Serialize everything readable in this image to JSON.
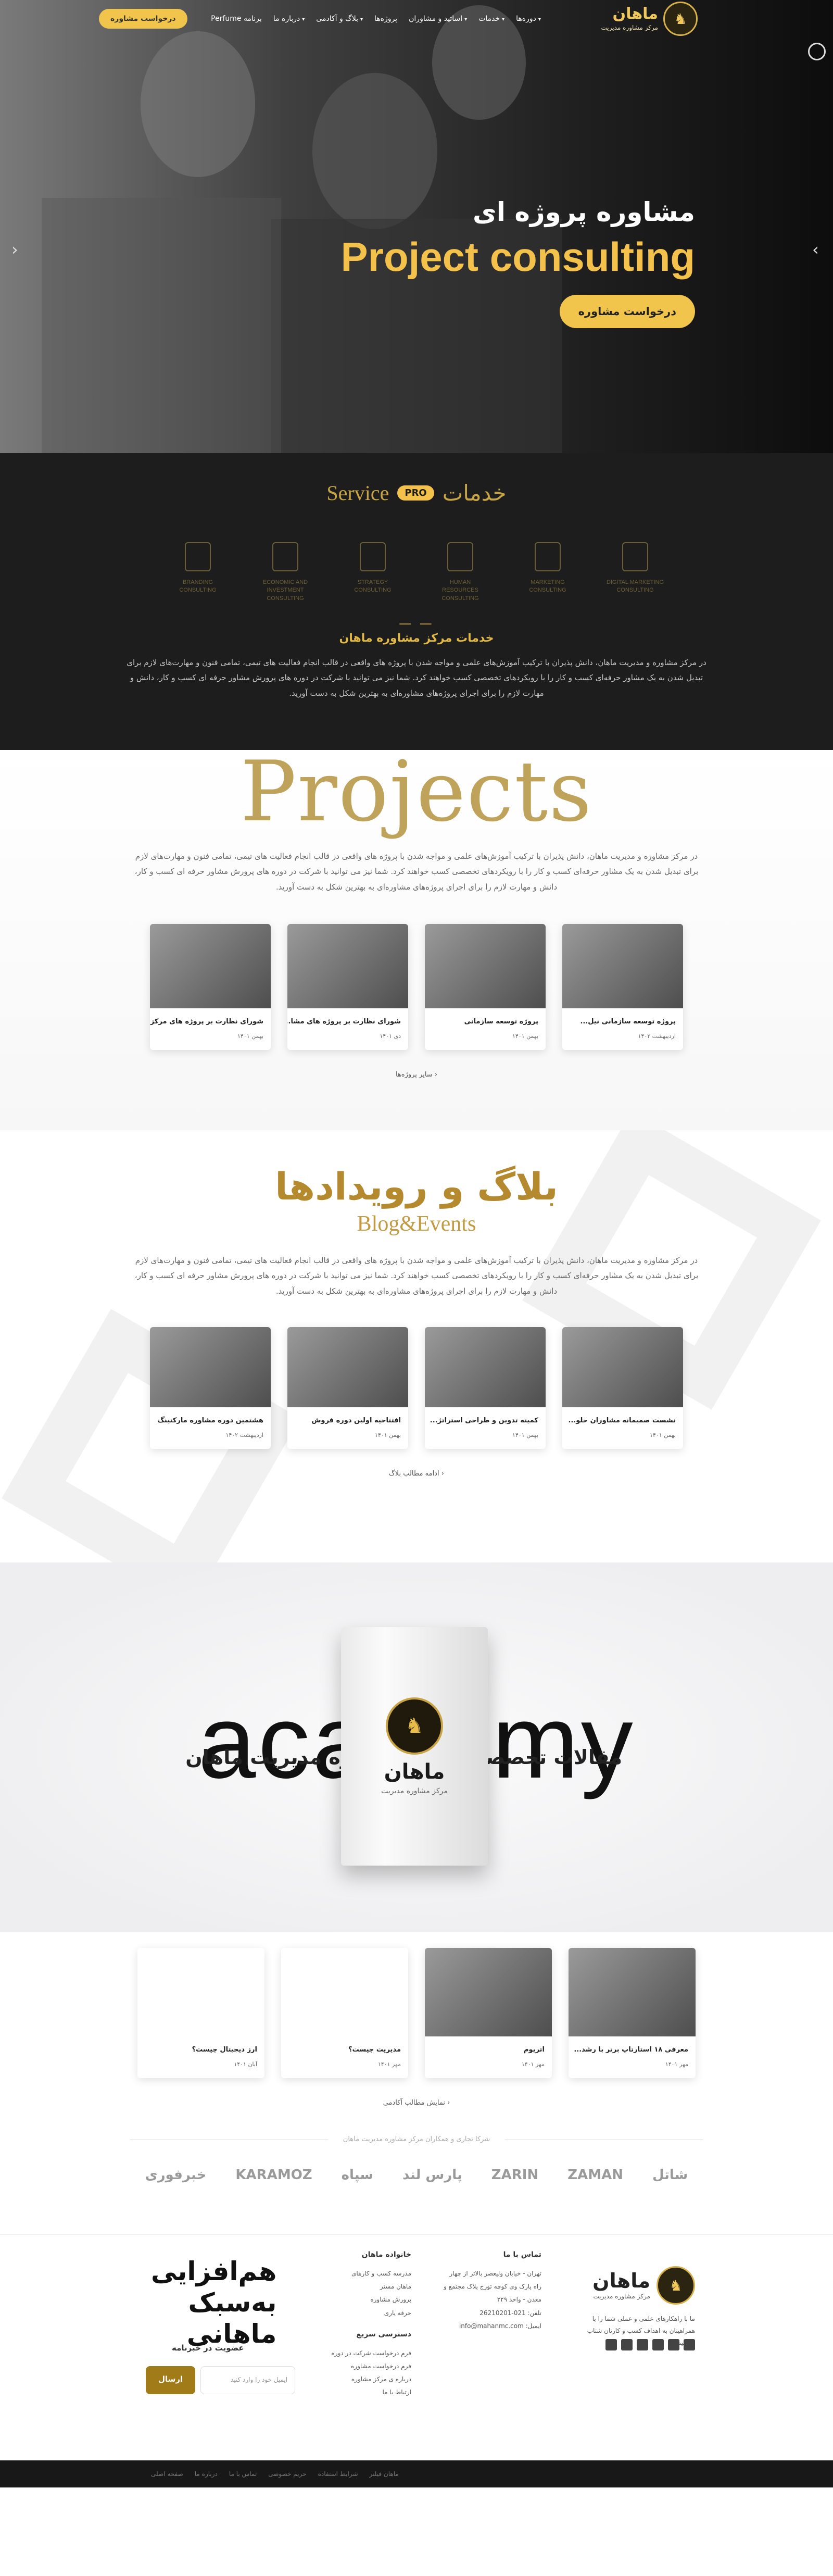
{
  "nav": {
    "logo_name": "ماهان",
    "logo_sub": "مرکز مشاوره مدیریت",
    "menu": [
      {
        "label": "دوره‌ها",
        "caret": true
      },
      {
        "label": "خدمات",
        "caret": true
      },
      {
        "label": "اساتید و مشاوران",
        "caret": true
      },
      {
        "label": "پروژه‌ها",
        "caret": false
      },
      {
        "label": "بلاگ و آکادمی",
        "caret": true
      },
      {
        "label": "درباره ما",
        "caret": true
      },
      {
        "label": "برنامه Perfume",
        "caret": false
      }
    ],
    "cta": "درخواست مشاوره"
  },
  "hero": {
    "title_fa": "مشاوره پروژه ای",
    "title_en": "Project consulting",
    "button": "درخواست مشاوره",
    "prev_icon": "chevron-left-icon",
    "next_icon": "chevron-right-icon"
  },
  "services": {
    "title_en": "Service",
    "badge": "PRO",
    "title_fa": "خدمات",
    "items": [
      {
        "label": "BRANDING CONSULTING"
      },
      {
        "label": "ECONOMIC AND INVESTMENT CONSULTING"
      },
      {
        "label": "STRATEGY CONSULTING"
      },
      {
        "label": "HUMAN RESOURCES CONSULTING"
      },
      {
        "label": "MARKETING CONSULTING"
      },
      {
        "label": "DIGITAL MARKETING CONSULTING"
      }
    ],
    "subtitle": "خدمات مرکز مشاوره ماهان",
    "paragraph": "در مرکز مشاوره و مدیریت ماهان، دانش پذیران با ترکیب آموزش‌های علمی و مواجه شدن با پروژه های واقعی در قالب انجام فعالیت های تیمی، تمامی فنون و مهارت‌های لازم برای تبدیل شدن به یک مشاور حرفه‌ای کسب و کار را با رویکردهای تخصصی کسب خواهند کرد. شما نیز می توانید با شرکت در دوره های پرورش مشاور حرفه ای کسب و کار، دانش و مهارت لازم را برای اجرای پروژه‌های مشاوره‌ای به بهترین شکل به دست آورید."
  },
  "projects": {
    "big_title": "Projects",
    "paragraph": "در مرکز مشاوره و مدیریت ماهان، دانش پذیران با ترکیب آموزش‌های علمی و مواجه شدن با پروژه های واقعی در قالب انجام فعالیت های تیمی، تمامی فنون و مهارت‌های لازم برای تبدیل شدن به یک مشاور حرفه‌ای کسب و کار را با رویکردهای تخصصی کسب خواهند کرد. شما نیز می توانید با شرکت در دوره های پرورش مشاور حرفه ای کسب و کار، دانش و مهارت لازم را برای اجرای پروژه‌های مشاوره‌ای به بهترین شکل به دست آورید.",
    "cards": [
      {
        "title": "پروژه توسعه سازمانی نیل...",
        "date": "اردیبهشت ۱۴۰۲"
      },
      {
        "title": "پروژه توسعه سازمانی",
        "date": "بهمن ۱۴۰۱"
      },
      {
        "title": "شورای نظارت بر پروژه های مشا...",
        "date": "دی ۱۴۰۱"
      },
      {
        "title": "شورای نظارت بر پروژه های مرکز ...",
        "date": "بهمن ۱۴۰۱"
      }
    ],
    "more": "سایر پروژه‌ها"
  },
  "blog": {
    "title_fa": "بلاگ و رویدادها",
    "title_en": "Blog&Events",
    "paragraph": "در مرکز مشاوره و مدیریت ماهان، دانش پذیران با ترکیب آموزش‌های علمی و مواجه شدن با پروژه های واقعی در قالب انجام فعالیت های تیمی، تمامی فنون و مهارت‌های لازم برای تبدیل شدن به یک مشاور حرفه‌ای کسب و کار را با رویکردهای تخصصی کسب خواهند کرد. شما نیز می توانید با شرکت در دوره های پرورش مشاور حرفه ای کسب و کار، دانش و مهارت لازم را برای اجرای پروژه‌های مشاوره‌ای به بهترین شکل به دست آورید.",
    "cards": [
      {
        "title": "نشست صمیمانه مشاوران حلو...",
        "date": "بهمن ۱۴۰۱"
      },
      {
        "title": "کمیته تدوین و طراحی استراتژ...",
        "date": "بهمن ۱۴۰۱"
      },
      {
        "title": "افتتاحیه اولین دوره فروش",
        "date": "بهمن ۱۴۰۱"
      },
      {
        "title": "هشتمین دوره مشاوره مارکتینگ",
        "date": "اردیبهشت ۱۴۰۲"
      }
    ],
    "more": "ادامه مطالب بلاگ"
  },
  "academy": {
    "word": "academy",
    "subtitle": "مقالات تخصصی مرکز مشاوره مدیریت ماهان",
    "book_name": "ماهان",
    "book_sub": "مرکز مشاوره مدیریت",
    "cards": [
      {
        "title": "معرفی ۱۸ استارتاپ برتر با رشد...",
        "date": "مهر ۱۴۰۱",
        "blank": false
      },
      {
        "title": "اتریوم",
        "date": "مهر ۱۴۰۱",
        "blank": false
      },
      {
        "title": "مدیریت چیست؟",
        "date": "مهر ۱۴۰۱",
        "blank": true
      },
      {
        "title": "ارز دیجیتال چیست؟",
        "date": "آبان ۱۴۰۱",
        "blank": true
      }
    ],
    "more": "نمایش مطالب آکادمی"
  },
  "partners": {
    "title": "شرکا تجاری و همکاران مرکز مشاوره مدیریت ماهان",
    "logos": [
      "شاتل",
      "ZAMAN",
      "ZARIN",
      "پارس لند",
      "سپاه",
      "KARAMOZ",
      "خبرفوری"
    ]
  },
  "footer": {
    "logo_name": "ماهان",
    "logo_sub": "مرکز مشاوره مدیریت",
    "desc": "ما با راهکارهای علمی و عملی شما را با همراهیتان به اهداف کسب و کارتان شتاب میدهیم",
    "contact_title": "تماس با ما",
    "contact_lines": [
      "تهران - خیابان ولیعصر بالاتر از چهار",
      "راه پارک وی کوچه تورج پلاک مجتمع و",
      "معدن - واحد ۲۲۹",
      "تلفن: 021-26210201",
      "ایمیل: info@mahanmc.com"
    ],
    "family_title": "خانواده ماهان",
    "family_links": [
      "مدرسه کسب و کارهای",
      "ماهان مستر",
      "پرورش مشاوره",
      "حرفه یاری"
    ],
    "quick_title": "دسترسی سریع",
    "quick_links": [
      "فرم درخواست شرکت در دوره",
      "فرم درخواست مشاوره",
      "درباره ی مرکز مشاوره",
      "ارتباط با ما"
    ],
    "slogan": [
      "هم‌افزایی",
      "به‌سبک",
      "ماهانی"
    ],
    "newsletter_label": "عضویت در خبرنامه",
    "newsletter_placeholder": "ایمیل خود را وارد کنید",
    "newsletter_button": "ارسال",
    "bottom_links": [
      "صفحه اصلی",
      "درباره ما",
      "تماس با ما",
      "حریم خصوصی",
      "شرایط استفاده",
      "ماهان فیلتر"
    ]
  }
}
